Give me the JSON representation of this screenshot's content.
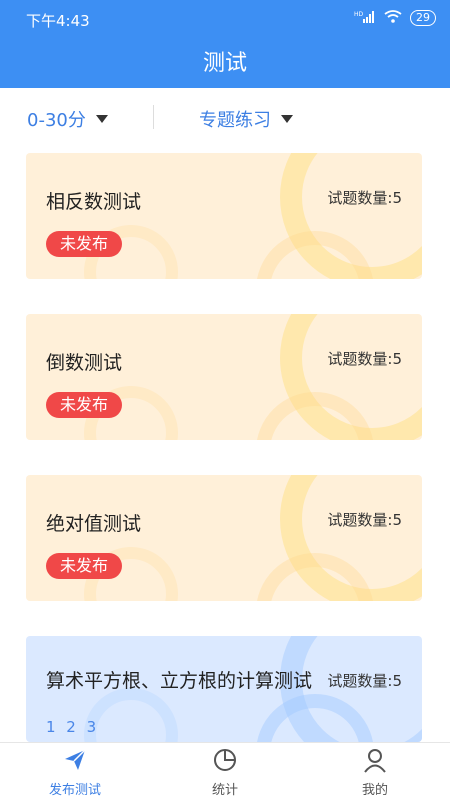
{
  "status": {
    "time": "下午4:43",
    "network": "HD",
    "battery": "29"
  },
  "header": {
    "title": "测试"
  },
  "filters": {
    "score": "0-30分",
    "type": "专题练习"
  },
  "cards": [
    {
      "title": "相反数测试",
      "count": "试题数量:5",
      "status": "未发布"
    },
    {
      "title": "倒数测试",
      "count": "试题数量:5",
      "status": "未发布"
    },
    {
      "title": "绝对值测试",
      "count": "试题数量:5",
      "status": "未发布"
    },
    {
      "title": "算术平方根、立方根的计算测试",
      "count": "试题数量:5",
      "sub": "1 2 3"
    }
  ],
  "tabs": [
    {
      "label": "发布测试",
      "icon": "send-icon",
      "active": true
    },
    {
      "label": "统计",
      "icon": "pie-chart-icon",
      "active": false
    },
    {
      "label": "我的",
      "icon": "user-icon",
      "active": false
    }
  ],
  "colors": {
    "primary": "#3d8ff3",
    "badge": "#f04848",
    "card_warm": "#fff0d9",
    "card_cool": "#dbe9ff"
  }
}
